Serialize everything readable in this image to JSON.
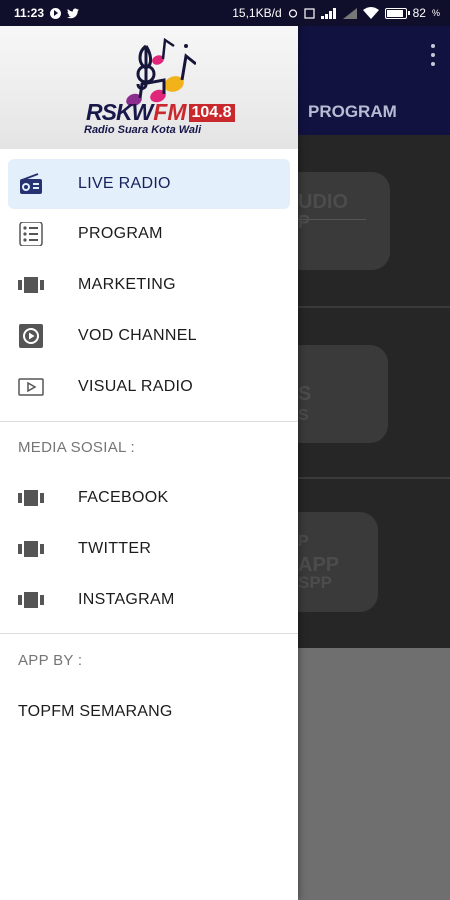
{
  "status_bar": {
    "time": "11:23",
    "network_speed": "15,1KB/d",
    "battery": "82"
  },
  "background": {
    "tab_label": "PROGRAM",
    "card_texts": [
      "UDIO",
      "P",
      "S",
      "S",
      "P",
      "APP",
      "SPP"
    ]
  },
  "drawer": {
    "logo": {
      "brand": "RSKW",
      "brand_suffix": "FM",
      "frequency": "104.8",
      "tagline": "Radio Suara Kota Wali"
    },
    "menu": [
      {
        "label": "LIVE RADIO",
        "icon": "radio-icon",
        "active": true
      },
      {
        "label": "PROGRAM",
        "icon": "list-icon",
        "active": false
      },
      {
        "label": "MARKETING",
        "icon": "carousel-icon",
        "active": false
      },
      {
        "label": "VOD CHANNEL",
        "icon": "play-box-icon",
        "active": false
      },
      {
        "label": "VISUAL RADIO",
        "icon": "play-outline-icon",
        "active": false
      }
    ],
    "social_title": "MEDIA SOSIAL :",
    "social": [
      {
        "label": "FACEBOOK",
        "icon": "carousel-icon"
      },
      {
        "label": "TWITTER",
        "icon": "carousel-icon"
      },
      {
        "label": "INSTAGRAM",
        "icon": "carousel-icon"
      }
    ],
    "app_by_title": "APP BY :",
    "app_by_name": "TOPFM SEMARANG"
  },
  "colors": {
    "header_dark": "#121240",
    "active_bg": "#e3effb",
    "brand_red": "#c9282d"
  }
}
